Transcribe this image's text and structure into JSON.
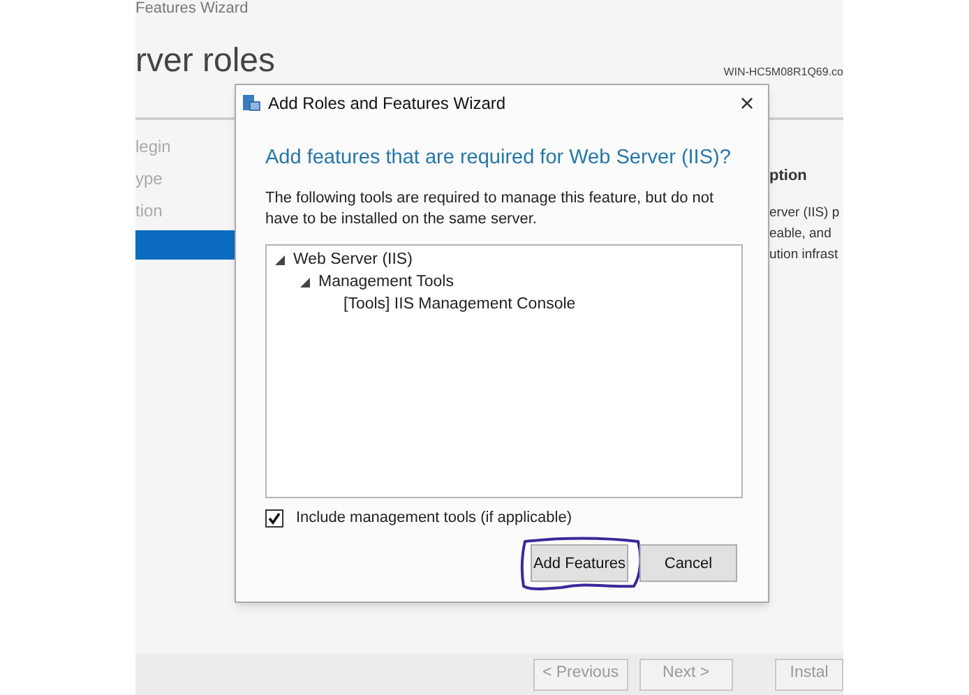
{
  "background_window": {
    "title": "Features Wizard",
    "heading": "rver roles",
    "server_name": "WIN-HC5M08R1Q69.co",
    "nav_items": [
      {
        "label": "legin",
        "selected": false
      },
      {
        "label": "ype",
        "selected": false
      },
      {
        "label": "tion",
        "selected": false
      },
      {
        "selected": true
      }
    ],
    "description": {
      "heading": "ption",
      "lines": [
        "erver (IIS) p",
        "eable, and",
        "ution infrast"
      ]
    },
    "buttons": [
      {
        "label": "< Previous"
      },
      {
        "label": "Next >"
      },
      {
        "label": "Instal"
      }
    ]
  },
  "dialog": {
    "title": "Add Roles and Features Wizard",
    "close": "×",
    "heading": "Add features that are required for Web Server (IIS)?",
    "message": "The following tools are required to manage this feature, but do not have to be installed on the same server.",
    "tree": [
      {
        "label": "Web Server (IIS)",
        "expanded": true,
        "children": [
          {
            "label": "Management Tools",
            "expanded": true,
            "children": [
              {
                "label": "[Tools] IIS Management Console"
              }
            ]
          }
        ]
      }
    ],
    "checkbox": {
      "label": "Include management tools (if applicable)",
      "checked": true
    },
    "buttons": [
      {
        "label": "Add Features",
        "highlighted": true
      },
      {
        "label": "Cancel",
        "highlighted": false
      }
    ]
  }
}
